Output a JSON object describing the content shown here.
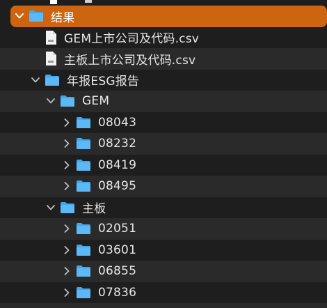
{
  "colors": {
    "selection": "#cd6410",
    "folder": "#3ea8f0",
    "background": "#1e1e1e",
    "alt_row": "#2a2a2a"
  },
  "tree": {
    "root": {
      "label": "结果",
      "expanded": true,
      "selected": true,
      "icon": "folder-icon"
    },
    "files": [
      {
        "label": "GEM上市公司及代码.csv",
        "icon": "csv-file-icon"
      },
      {
        "label": "主板上市公司及代码.csv",
        "icon": "csv-file-icon"
      }
    ],
    "report_folder": {
      "label": "年报ESG报告",
      "expanded": true,
      "icon": "folder-icon"
    },
    "gem_folder": {
      "label": "GEM",
      "expanded": true,
      "icon": "folder-icon"
    },
    "gem_items": [
      {
        "label": "08043",
        "expanded": false
      },
      {
        "label": "08232",
        "expanded": false
      },
      {
        "label": "08419",
        "expanded": false
      },
      {
        "label": "08495",
        "expanded": false
      }
    ],
    "main_folder": {
      "label": "主板",
      "expanded": true,
      "icon": "folder-icon"
    },
    "main_items": [
      {
        "label": "02051",
        "expanded": false
      },
      {
        "label": "03601",
        "expanded": false
      },
      {
        "label": "06855",
        "expanded": false
      },
      {
        "label": "07836",
        "expanded": false
      }
    ]
  }
}
